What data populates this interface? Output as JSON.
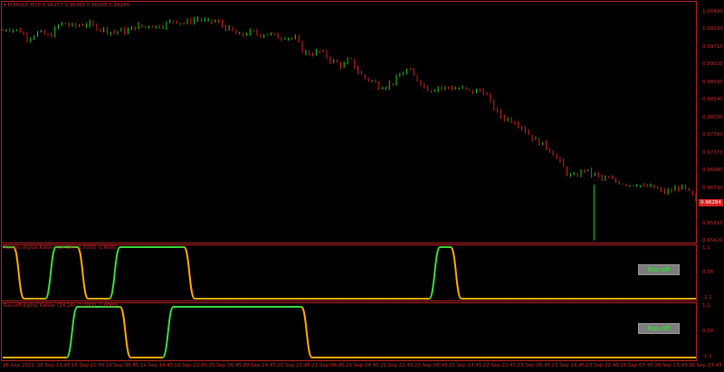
{
  "main_chart": {
    "title": "EURUSD,M15  0.96257 0.96365 0.96208 0.96284",
    "current_price": "0.96284",
    "price_labels": [
      "1.00490",
      "1.00100",
      "0.99710",
      "0.99320",
      "0.98930",
      "0.98540",
      "0.98150",
      "0.97760",
      "0.97370",
      "0.96980",
      "0.96590",
      "0.96200",
      "0.95810",
      "0.95420"
    ],
    "up_color": "#22c322",
    "down_color": "#d62020",
    "close_path": [
      1.0008,
      1.0013,
      1.0009,
      1.0006,
      0.9991,
      0.9996,
      1.0003,
      0.9999,
      0.9993,
      1.0012,
      1.0024,
      1.0021,
      1.0016,
      1.0019,
      1.0023,
      1.002,
      1.0015,
      1.0011,
      1.0007,
      1.0003,
      1.0008,
      1.0004,
      1.0013,
      1.0018,
      1.0014,
      1.0021,
      1.0016,
      1.0019,
      1.0023,
      1.0031,
      1.0027,
      1.0024,
      1.0029,
      1.0034,
      1.003,
      1.0026,
      1.0029,
      1.0022,
      1.0013,
      1.0007,
      0.9995,
      0.9999,
      1.0004,
      1.0001,
      0.9998,
      1.0002,
      0.9996,
      0.9992,
      0.9995,
      0.9991,
      0.9988,
      0.9963,
      0.9956,
      0.9958,
      0.9961,
      0.9951,
      0.994,
      0.9935,
      0.9928,
      0.9947,
      0.9925,
      0.9909,
      0.99,
      0.9895,
      0.9884,
      0.9885,
      0.989,
      0.9899,
      0.9913,
      0.9921,
      0.9905,
      0.9895,
      0.988,
      0.9876,
      0.9884,
      0.9879,
      0.9883,
      0.9878,
      0.988,
      0.9875,
      0.9871,
      0.9876,
      0.9872,
      0.9848,
      0.9828,
      0.9815,
      0.9812,
      0.9807,
      0.9798,
      0.9786,
      0.9771,
      0.9762,
      0.9754,
      0.9745,
      0.9731,
      0.9712,
      0.9693,
      0.9681,
      0.969,
      0.9701,
      0.969,
      0.9688,
      0.9678,
      0.968,
      0.9674,
      0.9672,
      0.9669,
      0.9666,
      0.9669,
      0.966,
      0.9662,
      0.9658,
      0.9652,
      0.9649,
      0.9654,
      0.9661,
      0.9658,
      0.9646,
      0.9628
    ]
  },
  "indicator1": {
    "title": "Ras-on digital Kahler (14,14) -1.0000 -1.0000",
    "labels": [
      "1.1",
      "0.00",
      "-1.1"
    ],
    "button_label": "Ras-off",
    "state_path": [
      1,
      1,
      -1,
      -1,
      -1,
      1,
      1,
      1,
      -1,
      -1,
      -1,
      1,
      1,
      1,
      1,
      1,
      1,
      1,
      -1,
      -1,
      -1,
      -1,
      -1,
      -1,
      -1,
      -1,
      -1,
      -1,
      -1,
      -1,
      -1,
      -1,
      -1,
      -1,
      -1,
      -1,
      -1,
      -1,
      -1,
      -1,
      -1,
      1,
      1,
      -1,
      -1,
      -1,
      -1,
      -1,
      -1,
      -1,
      -1,
      -1,
      -1,
      -1,
      -1,
      -1,
      -1,
      -1,
      -1,
      -1,
      -1,
      -1,
      -1,
      -1,
      -1,
      -1
    ]
  },
  "indicator2": {
    "title": "Ras-off digital Kahler (14,14) -1.0000 -1.0000",
    "labels": [
      "1.1",
      "0.00",
      "-1.1"
    ],
    "button_label": "Ras-off",
    "state_path": [
      -1,
      -1,
      -1,
      -1,
      -1,
      -1,
      -1,
      1,
      1,
      1,
      1,
      1,
      -1,
      -1,
      -1,
      -1,
      1,
      1,
      1,
      1,
      1,
      1,
      1,
      1,
      1,
      1,
      1,
      1,
      1,
      -1,
      -1,
      -1,
      -1,
      -1,
      -1,
      -1,
      -1,
      -1,
      -1,
      -1,
      -1,
      -1,
      -1,
      -1,
      -1,
      -1,
      -1,
      -1,
      -1,
      -1,
      -1,
      -1,
      -1,
      -1,
      -1,
      -1,
      -1,
      -1,
      -1,
      -1,
      -1,
      -1,
      -1,
      -1,
      -1,
      -1
    ]
  },
  "indicator_colors": {
    "up": "#39d639",
    "down": "#ffa500"
  },
  "time_labels": [
    "16 Sep 2022",
    "16 Sep 13:45",
    "16 Sep 21:45",
    "19 Sep 06:45",
    "19 Sep 14:45",
    "19 Sep 22:45",
    "20 Sep 06:45",
    "20 Sep 14:45",
    "20 Sep 22:45",
    "21 Sep 06:45",
    "21 Sep 14:45",
    "21 Sep 22:45",
    "22 Sep 06:45",
    "22 Sep 14:45",
    "22 Sep 22:45",
    "23 Sep 06:45",
    "23 Sep 14:45",
    "23 Sep 22:45",
    "26 Sep 07:45",
    "26 Sep 15:45",
    "26 Sep 23:45"
  ]
}
